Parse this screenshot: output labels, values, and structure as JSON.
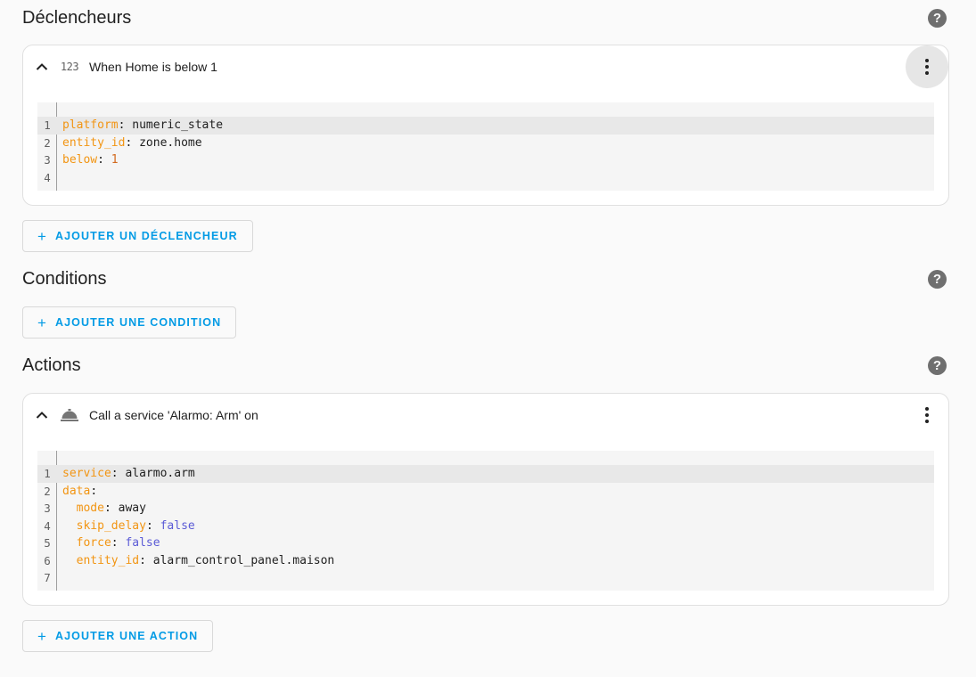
{
  "triggers": {
    "title": "Déclencheurs",
    "help_icon": "help-circle-icon",
    "card": {
      "type_icon_text": "123",
      "title": "When Home is below 1",
      "code_lines": [
        {
          "num": "1",
          "key": "platform",
          "value": "numeric_state",
          "value_type": "str"
        },
        {
          "num": "2",
          "key": "entity_id",
          "value": "zone.home",
          "value_type": "str"
        },
        {
          "num": "3",
          "key": "below",
          "value": "1",
          "value_type": "num"
        },
        {
          "num": "4",
          "key": "",
          "value": "",
          "value_type": "str"
        }
      ]
    },
    "add_label": "AJOUTER UN DÉCLENCHEUR"
  },
  "conditions": {
    "title": "Conditions",
    "help_icon": "help-circle-icon",
    "add_label": "AJOUTER UNE CONDITION"
  },
  "actions": {
    "title": "Actions",
    "help_icon": "help-circle-icon",
    "card": {
      "type_icon": "room-service-icon",
      "title": "Call a service 'Alarmo: Arm' on",
      "code_lines": [
        {
          "num": "1",
          "indent": "",
          "key": "service",
          "value": "alarmo.arm",
          "value_type": "str"
        },
        {
          "num": "2",
          "indent": "",
          "key": "data",
          "value": "",
          "value_type": "str"
        },
        {
          "num": "3",
          "indent": "  ",
          "key": "mode",
          "value": "away",
          "value_type": "str"
        },
        {
          "num": "4",
          "indent": "  ",
          "key": "skip_delay",
          "value": "false",
          "value_type": "bool"
        },
        {
          "num": "5",
          "indent": "  ",
          "key": "force",
          "value": "false",
          "value_type": "bool"
        },
        {
          "num": "6",
          "indent": "  ",
          "key": "entity_id",
          "value": "alarm_control_panel.maison",
          "value_type": "str"
        },
        {
          "num": "7",
          "indent": "",
          "key": "",
          "value": "",
          "value_type": "str"
        }
      ]
    },
    "add_label": "AJOUTER UNE ACTION"
  },
  "help_glyph": "?",
  "plus_glyph": "+",
  "colors": {
    "accent": "#039be5",
    "yaml_key": "#f29513",
    "yaml_number": "#d2691e",
    "yaml_bool": "#5b5bd6"
  }
}
